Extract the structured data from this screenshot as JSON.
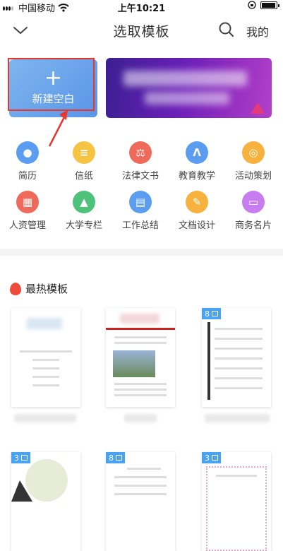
{
  "status_bar": {
    "carrier": "中国移动",
    "time": "上午10:21",
    "battery_level": 0.95
  },
  "nav": {
    "title": "选取模板",
    "right_label": "我的"
  },
  "new_card": {
    "plus": "+",
    "label": "新建空白"
  },
  "categories": [
    {
      "label": "简历",
      "color": "#5b9df0",
      "icon": "person-icon",
      "glyph": "●"
    },
    {
      "label": "信纸",
      "color": "#f6c343",
      "icon": "letter-icon",
      "glyph": "≡"
    },
    {
      "label": "法律文书",
      "color": "#ef6a5a",
      "icon": "gavel-icon",
      "glyph": "⚖"
    },
    {
      "label": "教育教学",
      "color": "#5b9df0",
      "icon": "education-icon",
      "glyph": "Λ"
    },
    {
      "label": "活动策划",
      "color": "#f6b23c",
      "icon": "balloon-icon",
      "glyph": "◎"
    },
    {
      "label": "人资管理",
      "color": "#ef6a5a",
      "icon": "hr-icon",
      "glyph": "▦"
    },
    {
      "label": "大学专栏",
      "color": "#4ec27a",
      "icon": "graduation-cap-icon",
      "glyph": "▲"
    },
    {
      "label": "工作总结",
      "color": "#5b9df0",
      "icon": "clipboard-icon",
      "glyph": "▤"
    },
    {
      "label": "文档设计",
      "color": "#f6b23c",
      "icon": "design-tools-icon",
      "glyph": "✎"
    },
    {
      "label": "商务名片",
      "color": "#c77df0",
      "icon": "card-icon",
      "glyph": "▭"
    }
  ],
  "hot": {
    "title": "最热模板",
    "templates": [
      {
        "badge": ""
      },
      {
        "badge": ""
      },
      {
        "badge": "8"
      },
      {
        "badge": "3"
      },
      {
        "badge": "8"
      },
      {
        "badge": "3"
      }
    ]
  }
}
